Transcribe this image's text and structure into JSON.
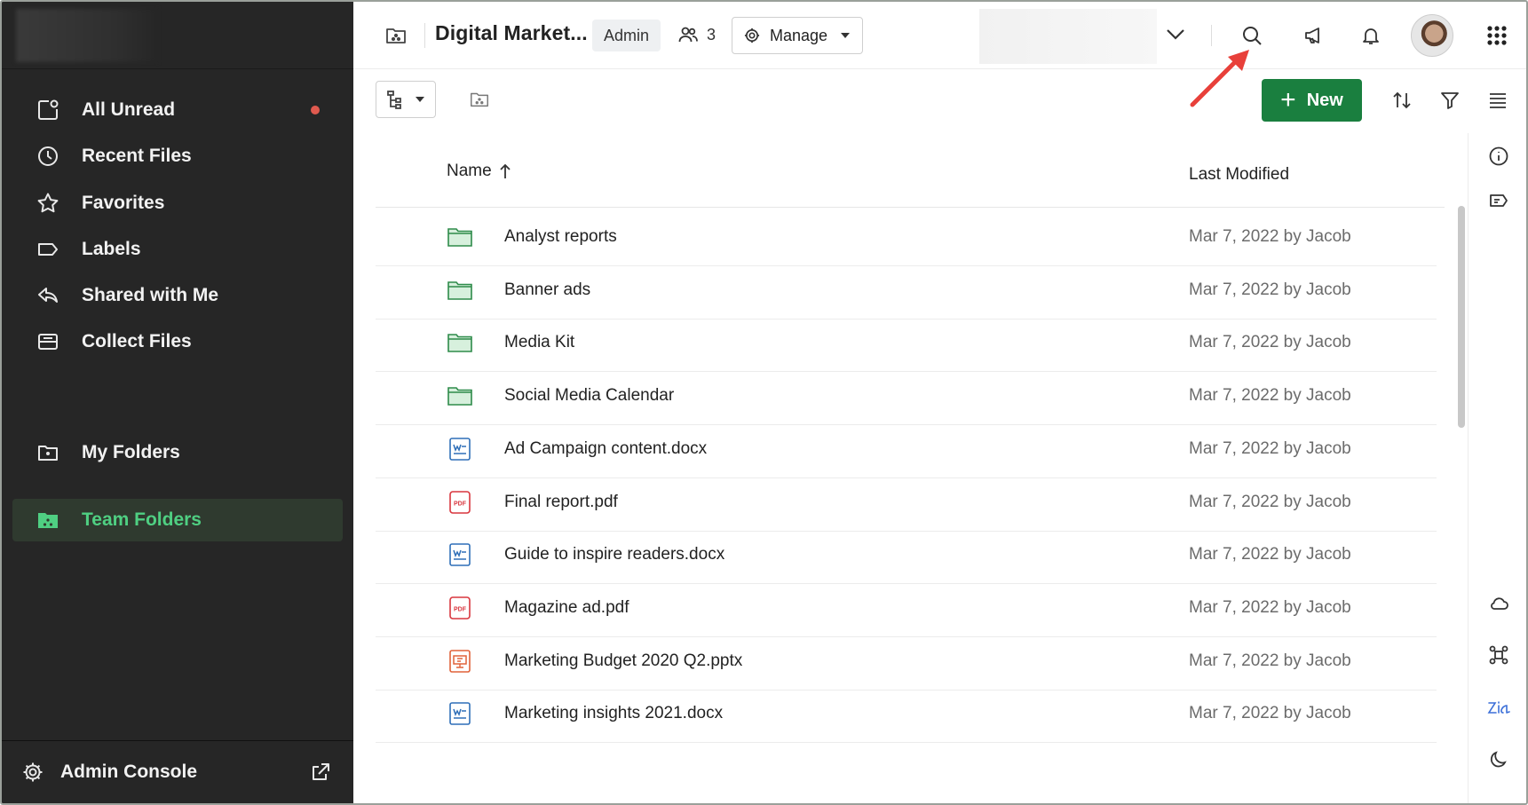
{
  "sidebar": {
    "items": [
      {
        "label": "All Unread",
        "icon": "all-unread-icon",
        "unread_dot": true,
        "active": false
      },
      {
        "label": "Recent Files",
        "icon": "clock-icon",
        "active": false
      },
      {
        "label": "Favorites",
        "icon": "star-icon",
        "active": false
      },
      {
        "label": "Labels",
        "icon": "label-icon",
        "active": false
      },
      {
        "label": "Shared with Me",
        "icon": "reply-icon",
        "active": false
      },
      {
        "label": "Collect Files",
        "icon": "tray-icon",
        "active": false
      },
      {
        "label": "My Folders",
        "icon": "folder-icon",
        "active": false
      },
      {
        "label": "Team Folders",
        "icon": "team-folder-icon",
        "active": true
      }
    ],
    "admin_console": "Admin Console",
    "unread_dot_color": "#e05a4f",
    "active_color": "#4fcf82"
  },
  "header": {
    "folder_title": "Digital Market...",
    "role_badge": "Admin",
    "members_count": "3",
    "manage_label": "Manage"
  },
  "toolbar": {
    "new_label": "New",
    "new_color": "#1a7f3f"
  },
  "table": {
    "columns": {
      "name": "Name",
      "modified": "Last Modified"
    },
    "rows": [
      {
        "name": "Analyst reports",
        "type": "folder",
        "modified": "Mar 7, 2022 by Jacob"
      },
      {
        "name": "Banner ads",
        "type": "folder",
        "modified": "Mar 7, 2022 by Jacob"
      },
      {
        "name": "Media Kit",
        "type": "folder",
        "modified": "Mar 7, 2022 by Jacob"
      },
      {
        "name": "Social Media Calendar",
        "type": "folder",
        "modified": "Mar 7, 2022 by Jacob"
      },
      {
        "name": "Ad Campaign content.docx",
        "type": "docx",
        "modified": "Mar 7, 2022 by Jacob"
      },
      {
        "name": "Final report.pdf",
        "type": "pdf",
        "modified": "Mar 7, 2022 by Jacob"
      },
      {
        "name": "Guide to inspire readers.docx",
        "type": "docx",
        "modified": "Mar 7, 2022 by Jacob"
      },
      {
        "name": "Magazine ad.pdf",
        "type": "pdf",
        "modified": "Mar 7, 2022 by Jacob"
      },
      {
        "name": "Marketing Budget 2020 Q2.pptx",
        "type": "pptx",
        "modified": "Mar 7, 2022 by Jacob"
      },
      {
        "name": "Marketing insights 2021.docx",
        "type": "docx",
        "modified": "Mar 7, 2022 by Jacob"
      }
    ]
  },
  "icons": {
    "folder_color": "#2e8b4a",
    "docx_color": "#2f6fb8",
    "pdf_color": "#d9363e",
    "pptx_color": "#e0623a"
  }
}
